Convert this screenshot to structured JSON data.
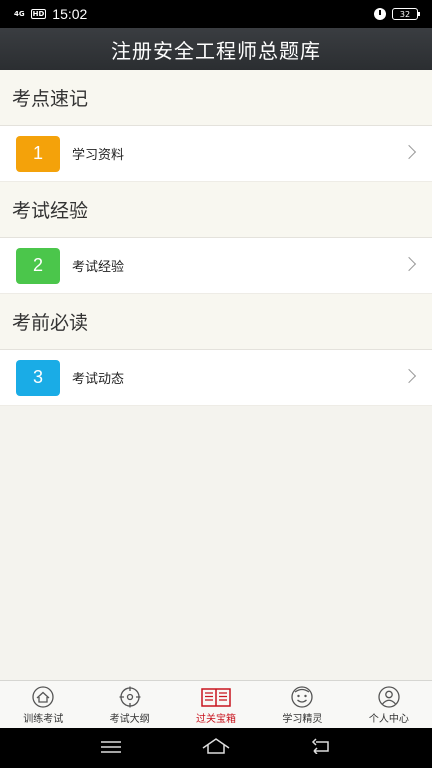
{
  "status_bar": {
    "network": "4G",
    "hd": "HD",
    "time": "15:02",
    "battery": "32"
  },
  "title": "注册安全工程师总题库",
  "sections": [
    {
      "header": "考点速记",
      "item": {
        "number": "1",
        "label": "学习资料",
        "color": "#f4a20a"
      }
    },
    {
      "header": "考试经验",
      "item": {
        "number": "2",
        "label": "考试经验",
        "color": "#4bc64b"
      }
    },
    {
      "header": "考前必读",
      "item": {
        "number": "3",
        "label": "考试动态",
        "color": "#1aace6"
      }
    }
  ],
  "bottom_nav": [
    {
      "label": "训练考试",
      "icon": "home-icon"
    },
    {
      "label": "考试大纲",
      "icon": "target-icon"
    },
    {
      "label": "过关宝箱",
      "icon": "book-icon",
      "active": true
    },
    {
      "label": "学习精灵",
      "icon": "smiley-icon"
    },
    {
      "label": "个人中心",
      "icon": "user-icon"
    }
  ],
  "colors": {
    "title_bar": "#2f3236",
    "active_tab": "#c8141e",
    "background": "#f4f3ee"
  }
}
